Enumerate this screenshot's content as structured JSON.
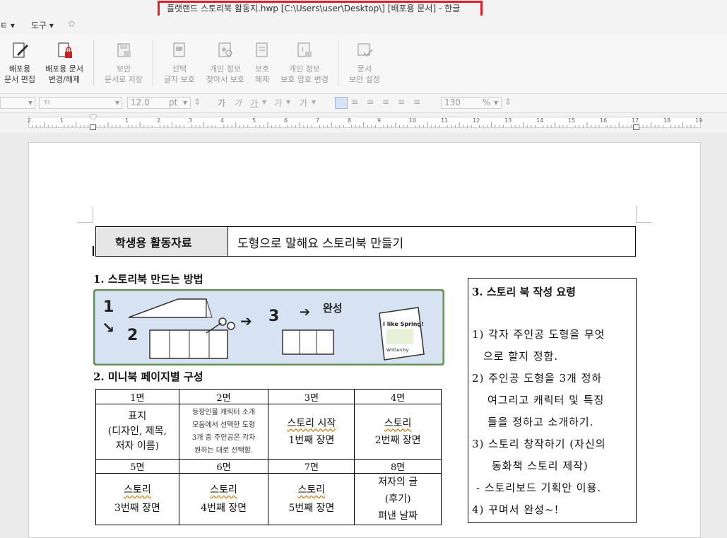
{
  "window": {
    "title": "플랫랜드 스토리북 활동지.hwp [C:\\Users\\user\\Desktop\\] [배포용 문서] - 한글"
  },
  "menu": {
    "items": [
      "도구"
    ],
    "partial_left": "ㅌ"
  },
  "ribbon": {
    "buttons": [
      {
        "line1": "배포용",
        "line2": "문서 편집",
        "enabled": true
      },
      {
        "line1": "배포용 문서",
        "line2": "변경/해제",
        "enabled": true
      },
      {
        "line1": "보안",
        "line2": "문서로 저장",
        "enabled": false
      },
      {
        "line1": "선택",
        "line2": "글자 보호",
        "enabled": false
      },
      {
        "line1": "개인 정보",
        "line2": "찾아서 보호",
        "enabled": false
      },
      {
        "line1": "보호",
        "line2": "해제",
        "enabled": false
      },
      {
        "line1": "개인 정보",
        "line2": "보호 암호 변경",
        "enabled": false
      },
      {
        "line1": "문서",
        "line2": "보안 설정",
        "enabled": false
      }
    ]
  },
  "format_toolbar": {
    "font_size": "12.0",
    "font_unit": "pt",
    "zoom": "130",
    "zoom_unit": "%",
    "font_glyph": "ㄲ"
  },
  "ruler": {
    "numbers": [
      "2",
      "1",
      "1",
      "2",
      "3",
      "4",
      "5",
      "6",
      "7",
      "8",
      "9",
      "10",
      "11",
      "12",
      "13",
      "14",
      "15",
      "16",
      "17",
      "18",
      "19"
    ]
  },
  "document": {
    "header": {
      "label": "학생용 활동자료",
      "title": "도형으로 말해요 스토리북 만들기"
    },
    "section1": {
      "heading": "1. 스토리북 만드는 방법",
      "illustration": {
        "step1": "1",
        "step2": "2",
        "step3": "3",
        "done": "완성",
        "book_title": "I like Spring!",
        "book_byline": "Written by"
      }
    },
    "section2": {
      "heading": "2. 미니북 페이지별 구성",
      "top_headers": [
        "1면",
        "2면",
        "3면",
        "4면"
      ],
      "top_cells": [
        [
          "표지",
          "(디자인, 제목,",
          "저자 이름)"
        ],
        [
          "등장인물 캐릭터 소개",
          "모둠에서 선택한 도형",
          "3개 중 주인공은 각자",
          "원하는 대로 선택함."
        ],
        [
          "스토리 시작",
          "1번째 장면"
        ],
        [
          "스토리",
          "2번째 장면"
        ]
      ],
      "bottom_headers": [
        "5면",
        "6면",
        "7면",
        "8면"
      ],
      "bottom_cells": [
        [
          "스토리",
          "3번째 장면"
        ],
        [
          "스토리",
          "4번째 장면"
        ],
        [
          "스토리",
          "5번째 장면"
        ],
        [
          "저자의 글",
          "(후기)",
          "펴낸 날짜"
        ]
      ]
    },
    "section3": {
      "heading": "3. 스토리 북 작성 요령",
      "lines": [
        "1) 각자 주인공 도형을 무엇",
        "으로 할지 정함.",
        "2) 주인공 도형을 3개 정하",
        "여그리고 캐릭터 및 특징",
        "들을 정하고 소개하기.",
        "3) 스토리 창작하기 (자신의",
        "동화책 스토리 제작)",
        "- 스토리보드 기획안 이용.",
        "4) 꾸며서 완성~!"
      ]
    }
  },
  "annotation": {
    "highlight_color": "#e0202a"
  }
}
